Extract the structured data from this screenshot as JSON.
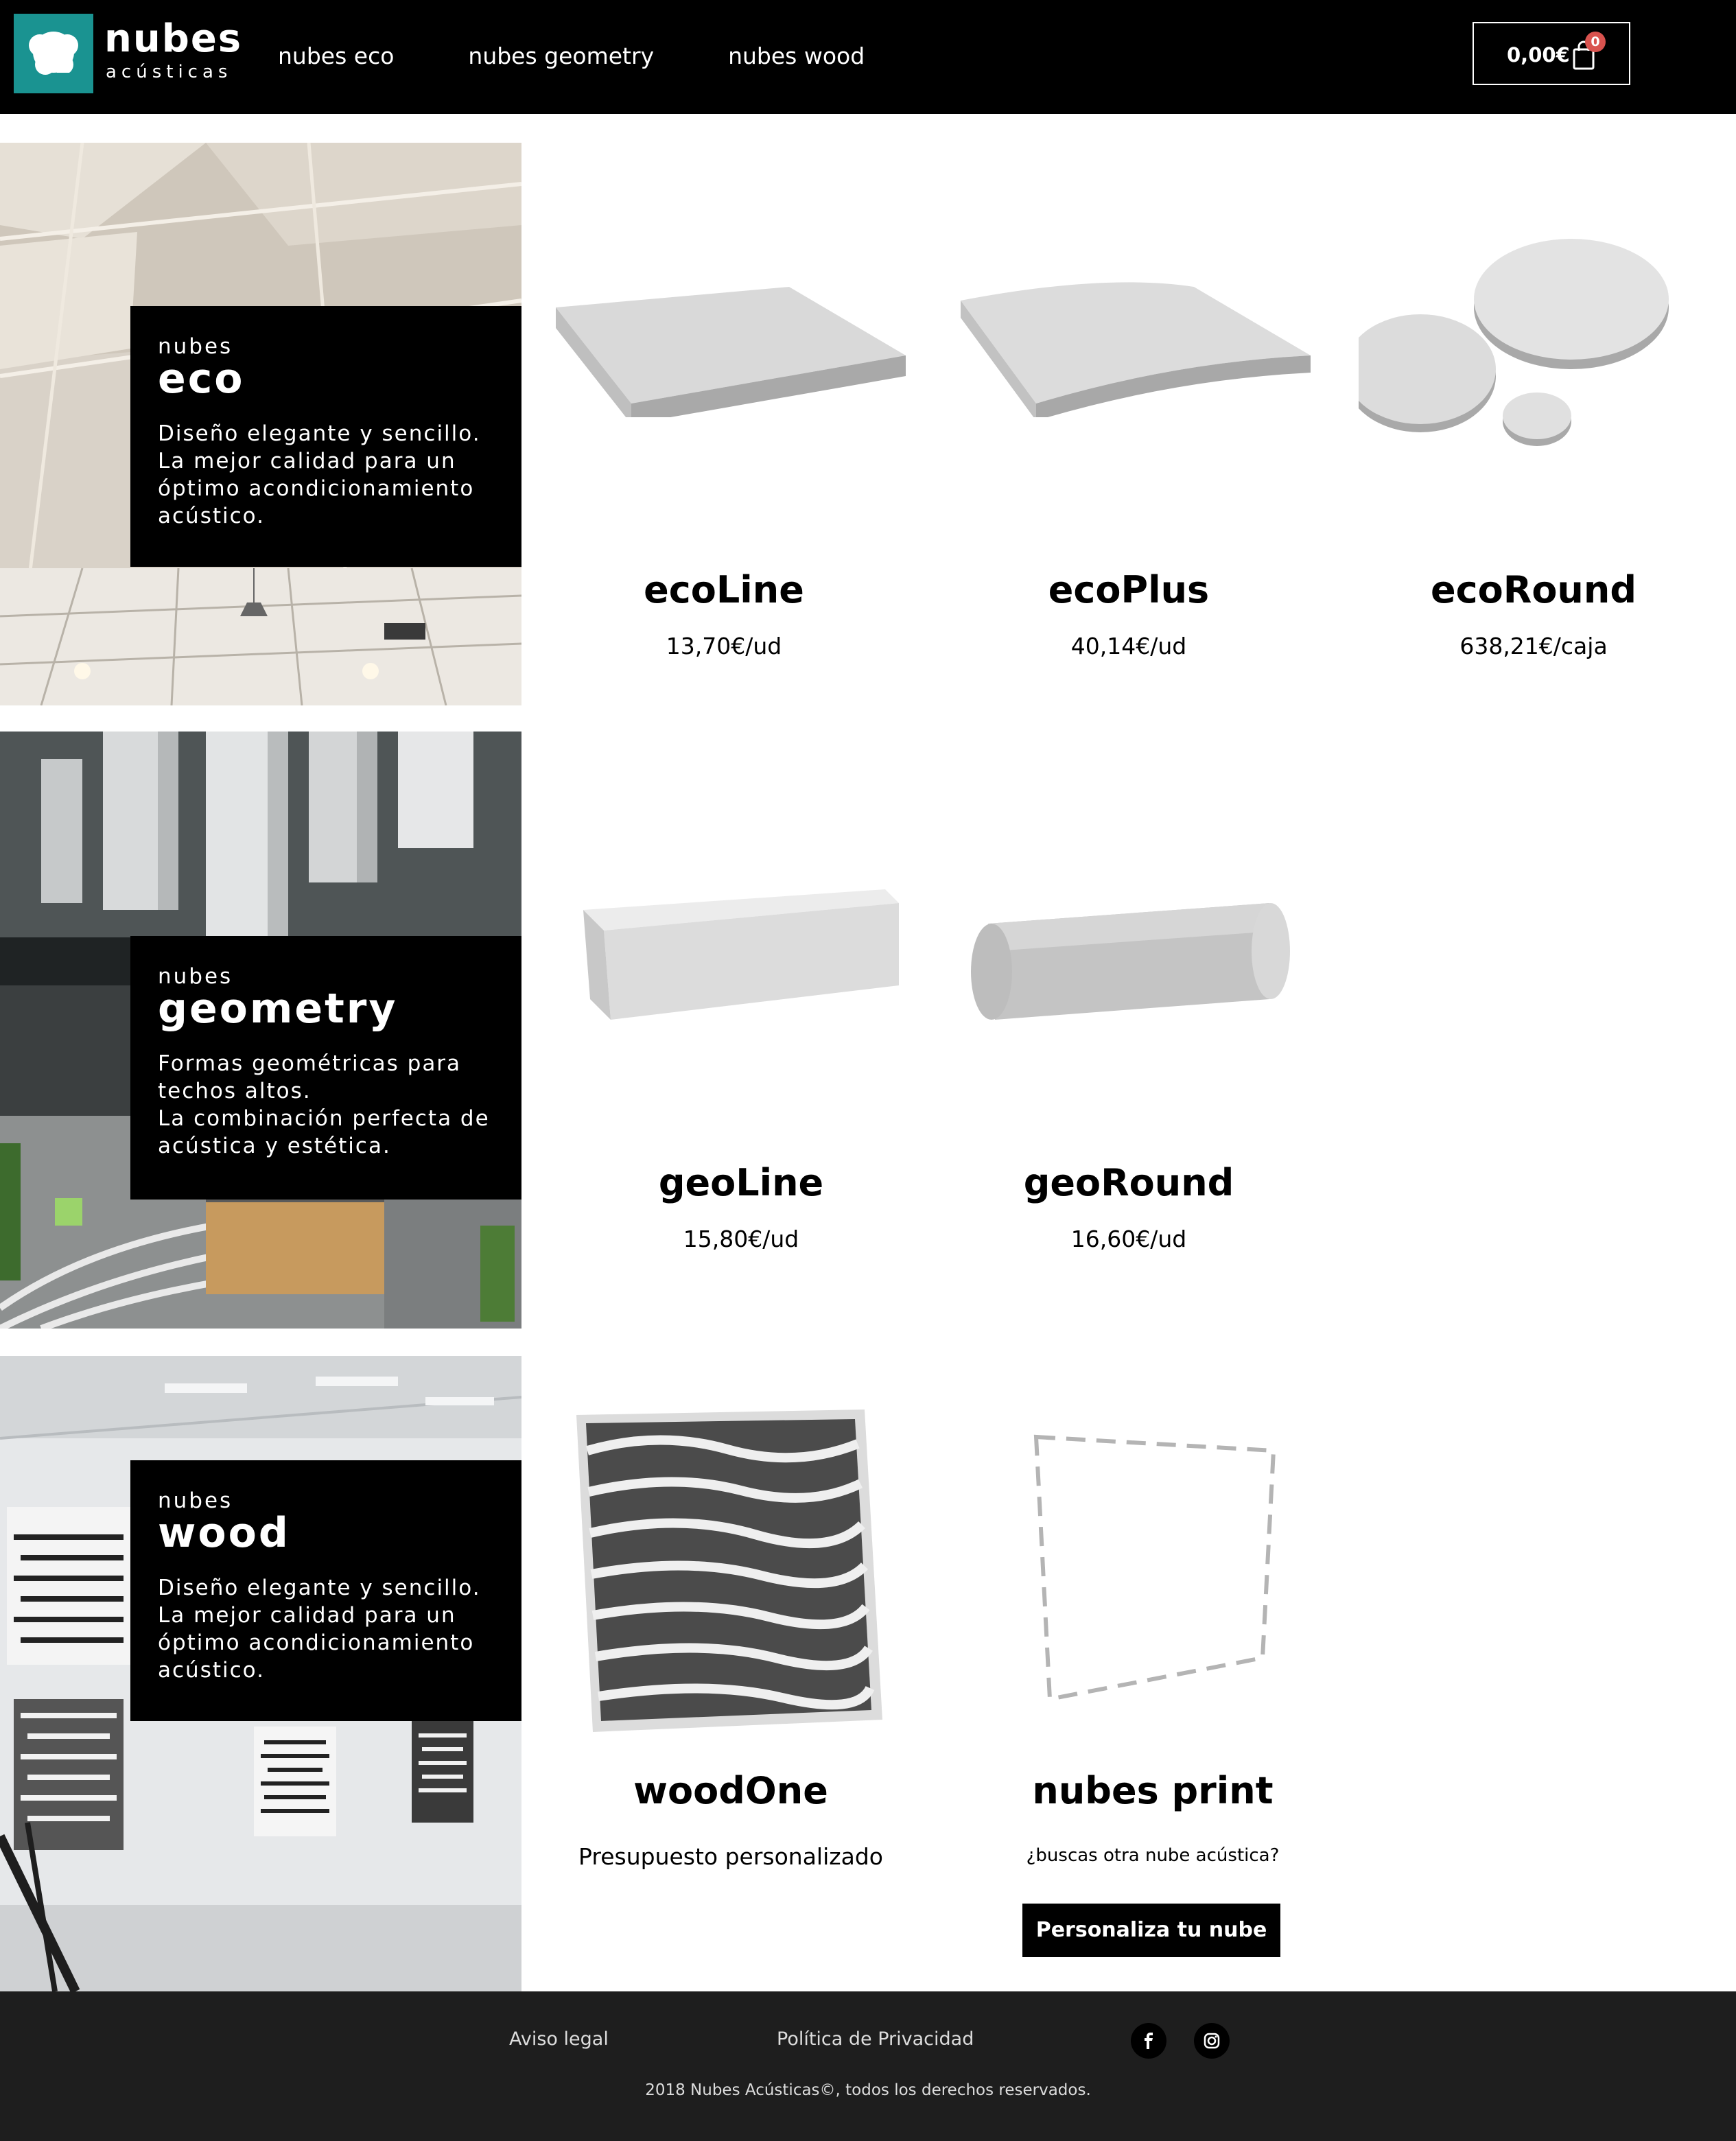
{
  "brand": {
    "name": "nubes",
    "sub": "acústicas",
    "color": "#1a9391"
  },
  "nav": [
    {
      "label": "nubes eco"
    },
    {
      "label": "nubes geometry"
    },
    {
      "label": "nubes wood"
    }
  ],
  "cart": {
    "total": "0,00€",
    "count": "0",
    "icon": "shopping-bag-icon"
  },
  "sections": [
    {
      "pre": "nubes",
      "title": "eco",
      "description": "Diseño elegante y sencillo.\nLa mejor calidad para un óptimo acondicionamiento acústico.",
      "products": [
        {
          "name": "ecoLine",
          "price": "13,70€/ud"
        },
        {
          "name": "ecoPlus",
          "price": "40,14€/ud"
        },
        {
          "name": "ecoRound",
          "price": "638,21€/caja"
        }
      ]
    },
    {
      "pre": "nubes",
      "title": "geometry",
      "description": "Formas geométricas para techos altos.\nLa combinación perfecta de acústica y estética.",
      "products": [
        {
          "name": "geoLine",
          "price": "15,80€/ud"
        },
        {
          "name": "geoRound",
          "price": "16,60€/ud"
        }
      ]
    },
    {
      "pre": "nubes",
      "title": "wood",
      "description": "Diseño elegante y sencillo.\nLa mejor calidad para un óptimo acondicionamiento acústico.",
      "products": [
        {
          "name": "woodOne",
          "price": "Presupuesto personalizado"
        },
        {
          "name": "nubes print",
          "note": "¿buscas otra nube acústica?",
          "button": "Personaliza tu nube"
        }
      ]
    }
  ],
  "footer": {
    "links": [
      "Aviso legal",
      "Política de Privacidad"
    ],
    "social": [
      "facebook-icon",
      "instagram-icon"
    ],
    "copyright": "2018 Nubes Acústicas©, todos los derechos reservados."
  }
}
